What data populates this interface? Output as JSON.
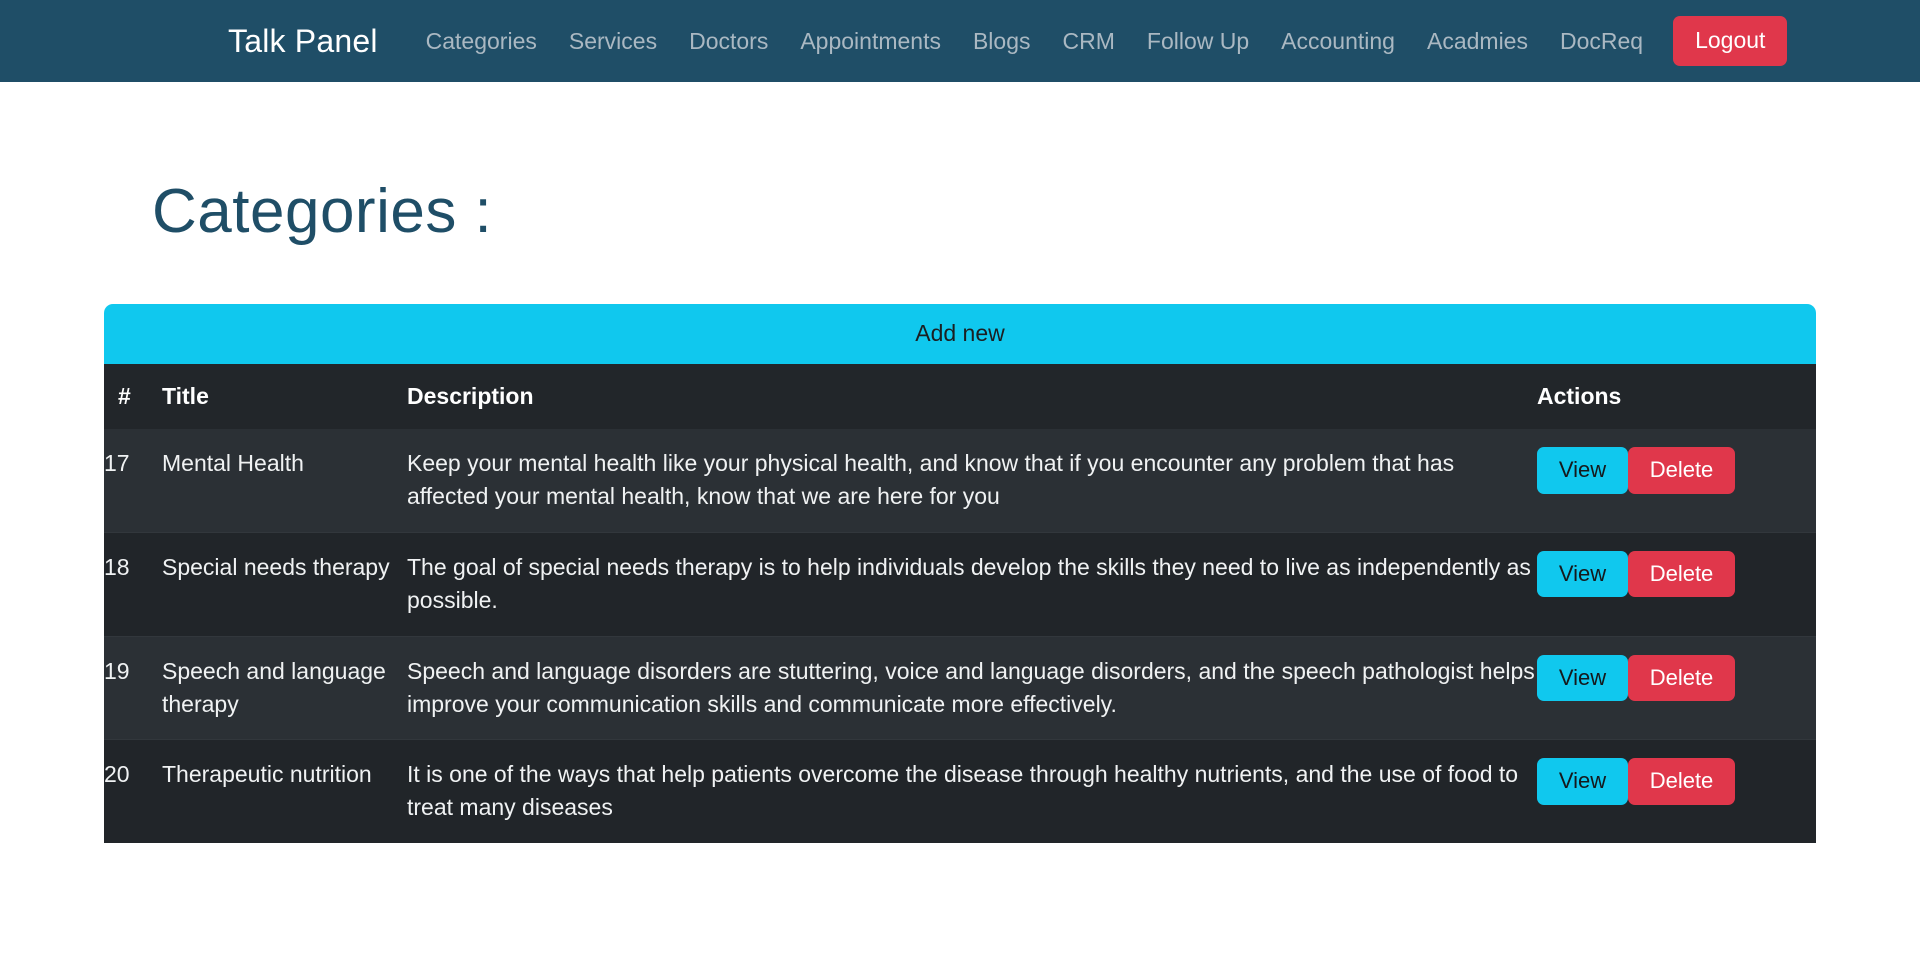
{
  "navbar": {
    "brand": "Talk Panel",
    "links": [
      {
        "label": "Categories"
      },
      {
        "label": "Services"
      },
      {
        "label": "Doctors"
      },
      {
        "label": "Appointments"
      },
      {
        "label": "Blogs"
      },
      {
        "label": "CRM"
      },
      {
        "label": "Follow Up"
      },
      {
        "label": "Accounting"
      },
      {
        "label": "Acadmies"
      },
      {
        "label": "DocReq"
      }
    ],
    "logout_label": "Logout",
    "bg_color": "#1f4e67",
    "logout_color": "#e0374b"
  },
  "page": {
    "title": "Categories :",
    "title_color": "#1f4e67"
  },
  "table": {
    "add_new_label": "Add new",
    "add_new_color": "#10c8ee",
    "headers": {
      "num": "#",
      "title": "Title",
      "description": "Description",
      "actions": "Actions"
    },
    "action_labels": {
      "view": "View",
      "delete": "Delete"
    },
    "rows": [
      {
        "num": "17",
        "title": "Mental Health",
        "description": "Keep your mental health like your physical health, and know that if you encounter any problem that has affected your mental health, know that we are here for you",
        "view": "View",
        "delete": "Delete"
      },
      {
        "num": "18",
        "title": "Special needs therapy",
        "description": "The goal of special needs therapy is to help individuals develop the skills they need to live as independently as possible.",
        "view": "View",
        "delete": "Delete"
      },
      {
        "num": "19",
        "title": "Speech and language therapy",
        "description": "Speech and language disorders are stuttering, voice and language disorders, and the speech pathologist helps improve your communication skills and communicate more effectively.",
        "view": "View",
        "delete": "Delete"
      },
      {
        "num": "20",
        "title": "Therapeutic nutrition",
        "description": "It is one of the ways that help patients overcome the disease through healthy nutrients, and the use of food to treat many diseases",
        "view": "View",
        "delete": "Delete"
      }
    ]
  }
}
